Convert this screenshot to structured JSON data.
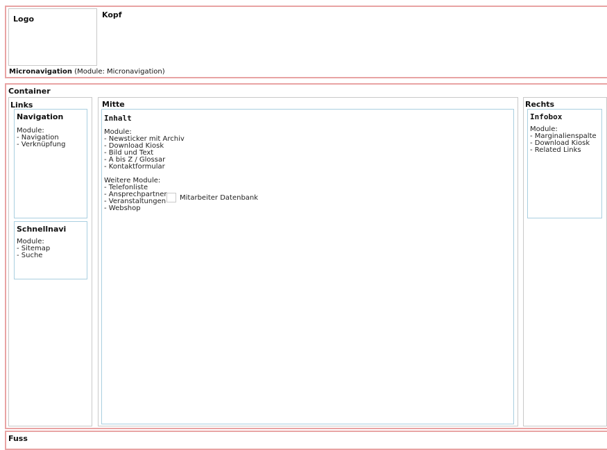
{
  "header": {
    "logo": "Logo",
    "kopf": "Kopf",
    "micronav_title": "Micronavigation",
    "micronav_note": "(Module: Micronavigation)"
  },
  "container": {
    "title": "Container",
    "links": {
      "title": "Links",
      "navigation": {
        "title": "Navigation",
        "text": "Module:\n- Navigation\n- Verknüpfung"
      },
      "schnellnavi": {
        "title": "Schnellnavi",
        "text": "Module:\n- Sitemap\n- Suche"
      }
    },
    "mitte": {
      "title": "Mitte",
      "inhalt": {
        "title": "Inhalt",
        "modules": "Module:\n- Newsticker mit Archiv\n- Download Kiosk\n- Bild und Text\n- A bis Z / Glossar\n- Kontaktformular",
        "weitere": "Weitere Module:\n- Telefonliste\n- Ansprechpartner",
        "veranstaltungen": "- Veranstaltungen",
        "webshop": "- Webshop",
        "mitarbeiter": "Mitarbeiter Datenbank"
      }
    },
    "rechts": {
      "title": "Rechts",
      "infobox": {
        "title": "Infobox",
        "text": "Module:\n- Marginalienspalte\n- Download Kiosk\n- Related Links"
      }
    }
  },
  "footer": {
    "title": "Fuss"
  }
}
